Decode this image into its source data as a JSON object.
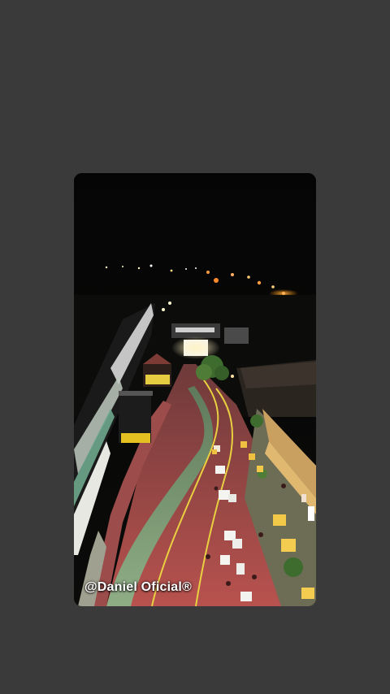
{
  "story": {
    "background_color": "#3a3a3a",
    "photo_description_icon": "night-aerial-street-photo",
    "watermark": "@Daniel Oficial®"
  }
}
